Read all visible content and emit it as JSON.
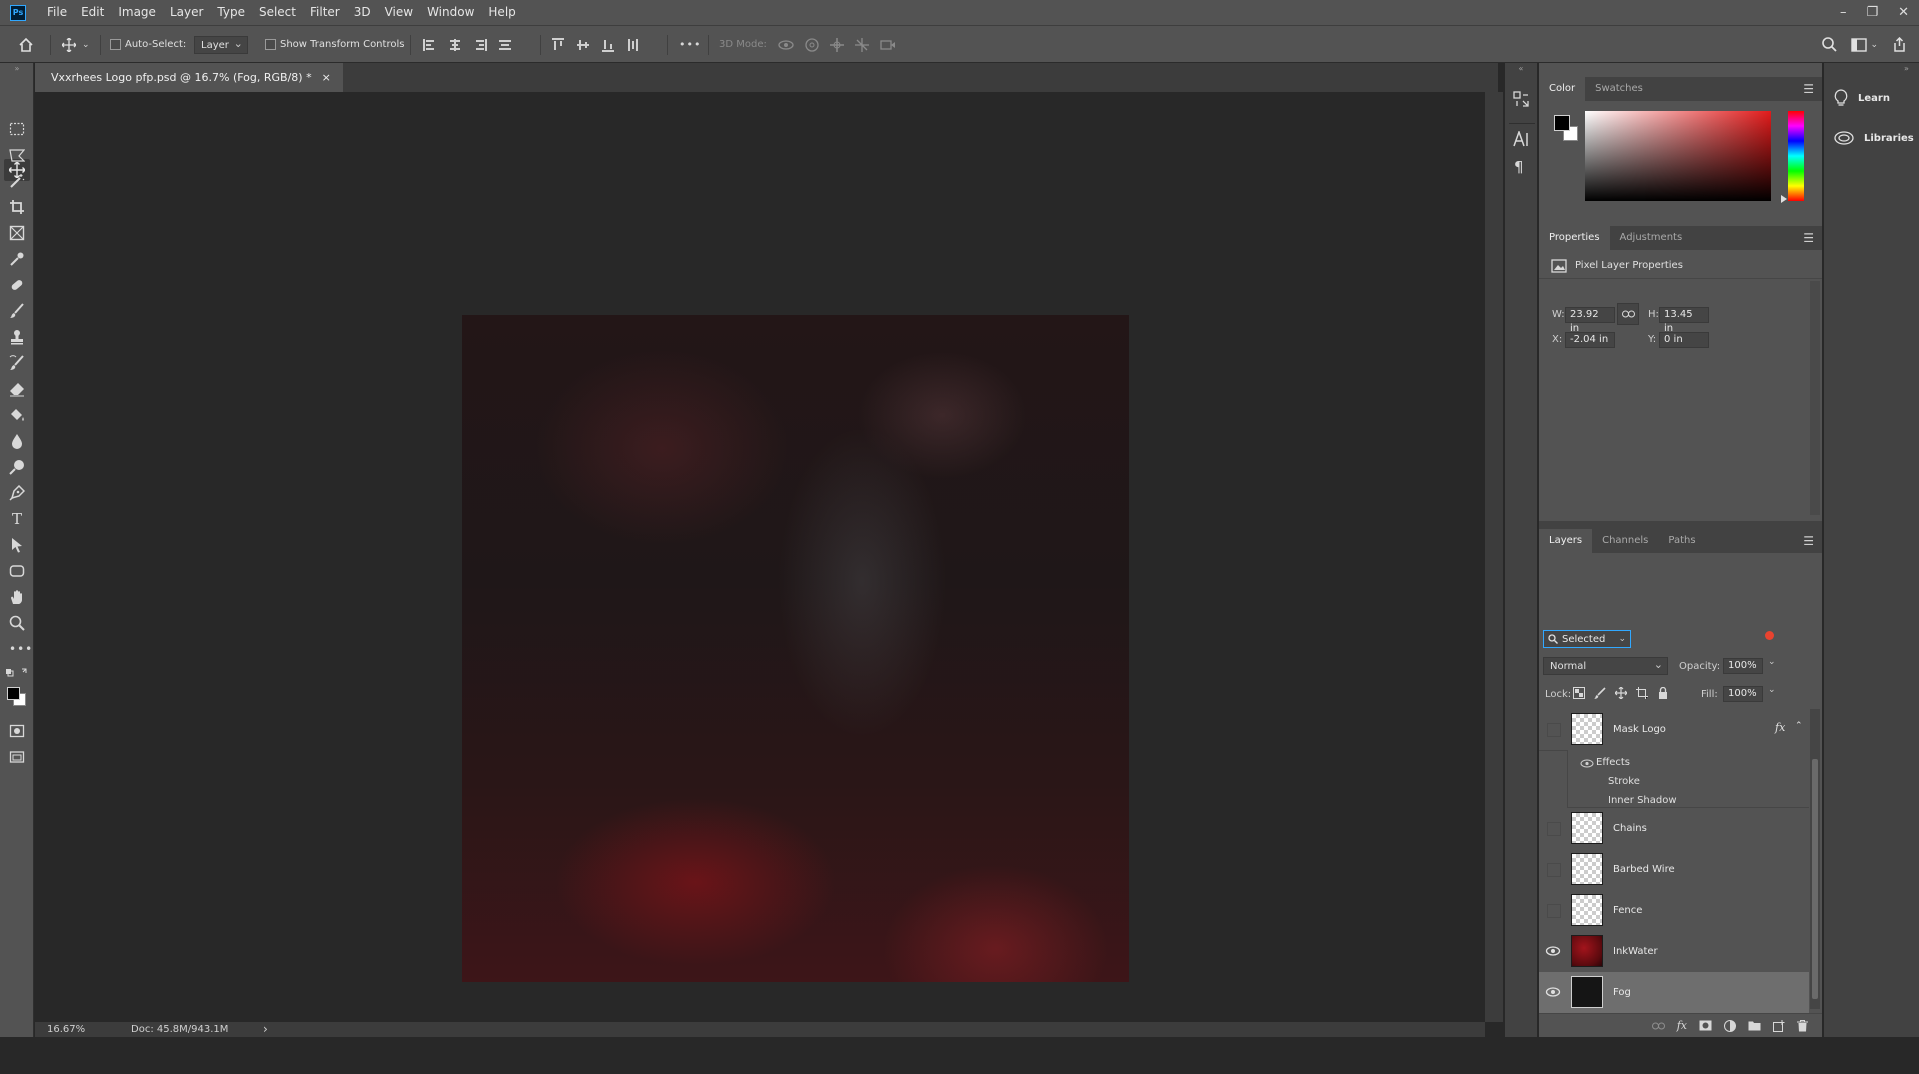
{
  "app": {
    "logo_text": "Ps"
  },
  "menu": [
    "File",
    "Edit",
    "Image",
    "Layer",
    "Type",
    "Select",
    "Filter",
    "3D",
    "View",
    "Window",
    "Help"
  ],
  "window_controls": {
    "minimize": "–",
    "restore": "❐",
    "close": "✕"
  },
  "options_bar": {
    "auto_select_label": "Auto-Select:",
    "auto_select_target": "Layer",
    "show_transform_label": "Show Transform Controls",
    "more": "•••",
    "mode_3d_label": "3D Mode:"
  },
  "document": {
    "tab_title": "Vxxrhees Logo pfp.psd @ 16.7% (Fog, RGB/8) *",
    "close": "×"
  },
  "status": {
    "zoom": "16.67%",
    "doc": "Doc: 45.8M/943.1M",
    "arrow": "›"
  },
  "color_panel": {
    "tabs": [
      "Color",
      "Swatches"
    ],
    "foreground": "#000000",
    "background": "#ffffff",
    "hue": "#ff0000"
  },
  "properties_panel": {
    "tabs": [
      "Properties",
      "Adjustments"
    ],
    "header": "Pixel Layer Properties",
    "w_label": "W:",
    "w_value": "23.92 in",
    "h_label": "H:",
    "h_value": "13.45 in",
    "x_label": "X:",
    "x_value": "-2.04 in",
    "y_label": "Y:",
    "y_value": "0 in"
  },
  "layers_panel": {
    "tabs": [
      "Layers",
      "Channels",
      "Paths"
    ],
    "filter": "Selected",
    "blend_mode": "Normal",
    "opacity_label": "Opacity:",
    "opacity": "100%",
    "lock_label": "Lock:",
    "fill_label": "Fill:",
    "fill": "100%",
    "fx_label": "fx",
    "layers": [
      {
        "name": "Mask Logo",
        "visible": false,
        "has_fx": true,
        "effects_label": "Effects",
        "effects": [
          "Stroke",
          "Inner Shadow"
        ]
      },
      {
        "name": "Chains",
        "visible": false
      },
      {
        "name": "Barbed Wire",
        "visible": false
      },
      {
        "name": "Fence",
        "visible": false
      },
      {
        "name": "InkWater",
        "visible": true
      },
      {
        "name": "Fog",
        "visible": true,
        "selected": true
      }
    ],
    "footer_icons": [
      "link-icon",
      "fx-icon",
      "mask-icon",
      "adjustment-icon",
      "folder-icon",
      "new-layer-icon",
      "trash-icon"
    ]
  },
  "right_column": {
    "learn": "Learn",
    "libraries": "Libraries"
  }
}
